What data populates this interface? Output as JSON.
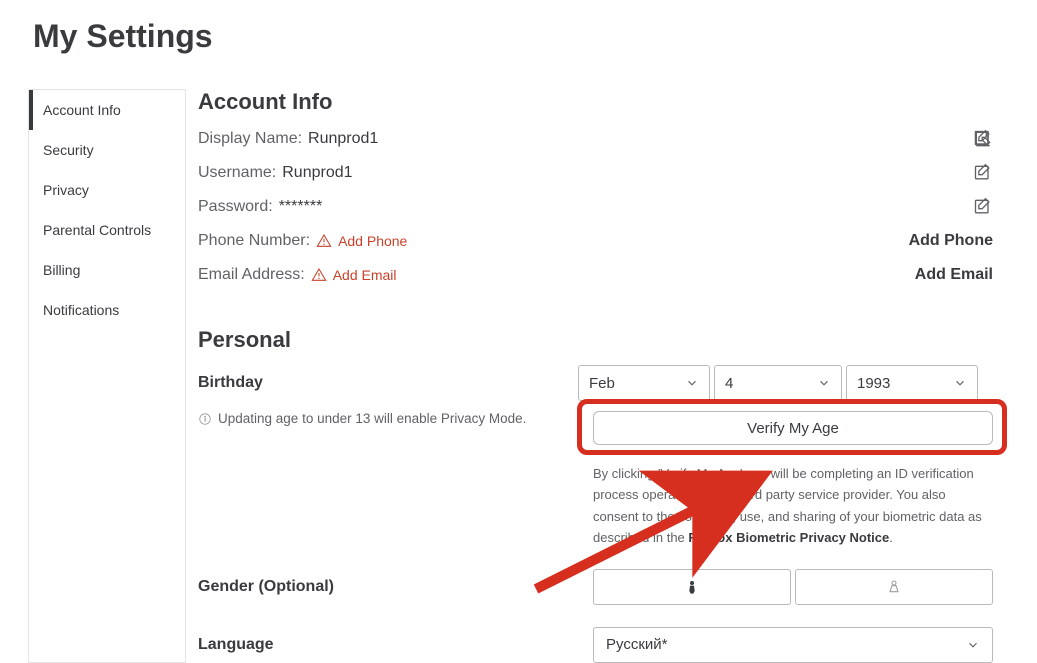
{
  "page_title": "My Settings",
  "sidebar": {
    "items": [
      {
        "label": "Account Info",
        "active": true
      },
      {
        "label": "Security",
        "active": false
      },
      {
        "label": "Privacy",
        "active": false
      },
      {
        "label": "Parental Controls",
        "active": false
      },
      {
        "label": "Billing",
        "active": false
      },
      {
        "label": "Notifications",
        "active": false
      }
    ]
  },
  "account": {
    "heading": "Account Info",
    "display_name_label": "Display Name:",
    "display_name_value": "Runprod1",
    "username_label": "Username:",
    "username_value": "Runprod1",
    "password_label": "Password:",
    "password_value": "*******",
    "phone_label": "Phone Number:",
    "phone_add_text": "Add Phone",
    "phone_action": "Add Phone",
    "email_label": "Email Address:",
    "email_add_text": "Add Email",
    "email_action": "Add Email"
  },
  "personal": {
    "heading": "Personal",
    "birthday_label": "Birthday",
    "month": "Feb",
    "day": "4",
    "year": "1993",
    "age_note": "Updating age to under 13 will enable Privacy Mode.",
    "verify_button": "Verify My Age",
    "consent_pre": "By clicking 'Verify My Age' you will be completing an ID verification process operated by our third party service provider. You also consent to the collection, use, and sharing of your biometric data as described in the ",
    "consent_link": "Roblox Biometric Privacy Notice",
    "consent_post": ".",
    "gender_label": "Gender (Optional)",
    "language_label": "Language",
    "language_value": "Русский*"
  }
}
